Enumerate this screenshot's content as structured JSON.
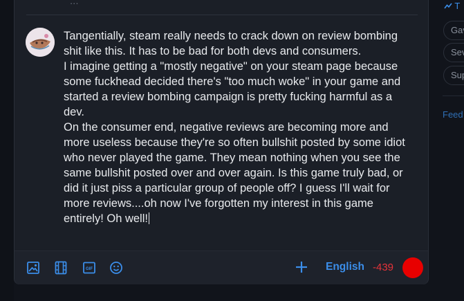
{
  "composer": {
    "previous_text_fragment": "...",
    "reply_text": "Tangentially, steam really needs to crack down on review bombing shit like this. It has to be bad for both devs and consumers.\nI imagine getting a \"mostly negative\" on your steam page because some fuckhead decided there's \"too much woke\" in your game and started a review bombing campaign is pretty fucking harmful as a dev.\nOn the consumer end, negative reviews are becoming more and more useless because they're so often bullshit posted by some idiot who never played the game. They mean nothing when you see the same bullshit posted over and over again. Is this game truly bad, or did it just piss a particular group of people off? I guess I'll wait for more reviews....oh now I've forgotten my interest in this game entirely! Oh well!"
  },
  "toolbar": {
    "icons": [
      "image-icon",
      "video-icon",
      "gif-icon",
      "emoji-icon"
    ],
    "gif_label": "GIF",
    "plus_icon": "plus-icon",
    "language_label": "English",
    "char_count": "-439",
    "send_color": "#e80000"
  },
  "sidebar": {
    "trending_fragment": "T",
    "chips": [
      "Gav",
      "Sev",
      "Sup"
    ],
    "feed_fragment": "Feed"
  },
  "colors": {
    "accent": "#3b8eea",
    "warning": "#e5333a",
    "background": "#11141b",
    "panel": "#1b1f27"
  }
}
